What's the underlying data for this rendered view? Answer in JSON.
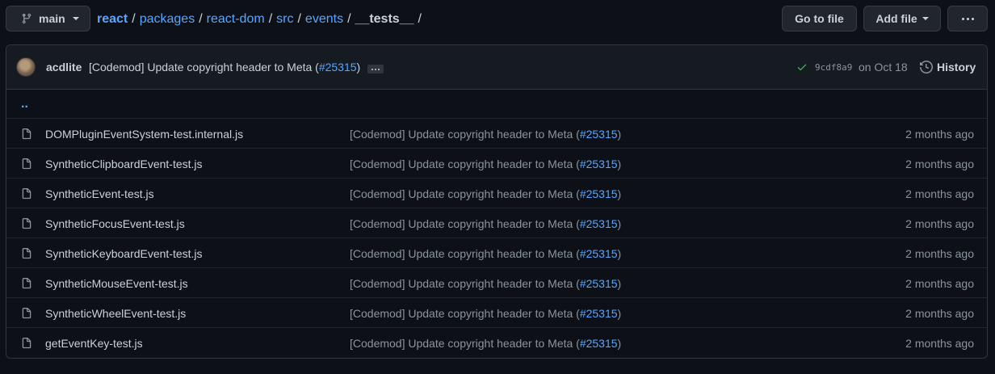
{
  "branch": {
    "name": "main"
  },
  "breadcrumb": {
    "root": "react",
    "segments": [
      "packages",
      "react-dom",
      "src",
      "events"
    ],
    "current": "__tests__",
    "separator": "/"
  },
  "actions": {
    "goto_label": "Go to file",
    "add_label": "Add file"
  },
  "commit": {
    "author": "acdlite",
    "message_prefix": "[Codemod] Update copyright header to Meta (",
    "pr": "#25315",
    "message_suffix": ")",
    "sha": "9cdf8a9",
    "date": "on Oct 18",
    "history_label": "History"
  },
  "parent_dir": "..",
  "files": [
    {
      "name": "DOMPluginEventSystem-test.internal.js",
      "msg": "[Codemod] Update copyright header to Meta (",
      "pr": "#25315",
      "age": "2 months ago"
    },
    {
      "name": "SyntheticClipboardEvent-test.js",
      "msg": "[Codemod] Update copyright header to Meta (",
      "pr": "#25315",
      "age": "2 months ago"
    },
    {
      "name": "SyntheticEvent-test.js",
      "msg": "[Codemod] Update copyright header to Meta (",
      "pr": "#25315",
      "age": "2 months ago"
    },
    {
      "name": "SyntheticFocusEvent-test.js",
      "msg": "[Codemod] Update copyright header to Meta (",
      "pr": "#25315",
      "age": "2 months ago"
    },
    {
      "name": "SyntheticKeyboardEvent-test.js",
      "msg": "[Codemod] Update copyright header to Meta (",
      "pr": "#25315",
      "age": "2 months ago"
    },
    {
      "name": "SyntheticMouseEvent-test.js",
      "msg": "[Codemod] Update copyright header to Meta (",
      "pr": "#25315",
      "age": "2 months ago"
    },
    {
      "name": "SyntheticWheelEvent-test.js",
      "msg": "[Codemod] Update copyright header to Meta (",
      "pr": "#25315",
      "age": "2 months ago"
    },
    {
      "name": "getEventKey-test.js",
      "msg": "[Codemod] Update copyright header to Meta (",
      "pr": "#25315",
      "age": "2 months ago"
    }
  ],
  "colors": {
    "background": "#0d1117",
    "link": "#58a6ff",
    "success": "#3fb950",
    "muted": "#8b949e"
  }
}
